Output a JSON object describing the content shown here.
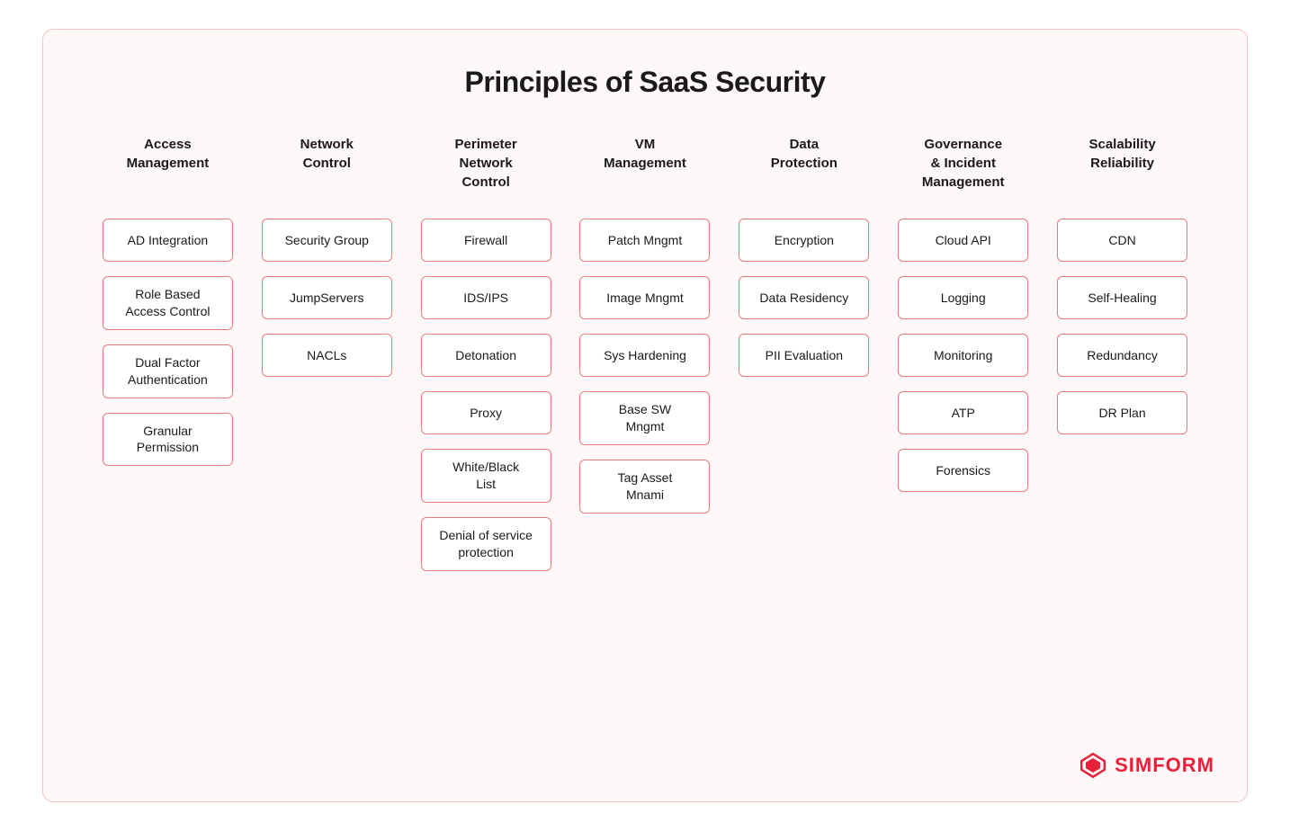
{
  "title": "Principles of SaaS Security",
  "columns": [
    {
      "id": "access-management",
      "header": "Access\nManagement",
      "items": [
        "AD Integration",
        "Role Based\nAccess Control",
        "Dual Factor\nAuthentication",
        "Granular\nPermission"
      ]
    },
    {
      "id": "network-control",
      "header": "Network\nControl",
      "items": [
        "Security Group",
        "JumpServers",
        "NACLs"
      ]
    },
    {
      "id": "perimeter-network-control",
      "header": "Perimeter\nNetwork\nControl",
      "items": [
        "Firewall",
        "IDS/IPS",
        "Detonation",
        "Proxy",
        "White/Black\nList",
        "Denial of service\nprotection"
      ]
    },
    {
      "id": "vm-management",
      "header": "VM\nManagement",
      "items": [
        "Patch Mngmt",
        "Image Mngmt",
        "Sys Hardening",
        "Base SW\nMngmt",
        "Tag Asset\nMnami"
      ]
    },
    {
      "id": "data-protection",
      "header": "Data\nProtection",
      "items": [
        "Encryption",
        "Data Residency",
        "PII Evaluation"
      ]
    },
    {
      "id": "governance-incident-management",
      "header": "Governance\n& Incident\nManagement",
      "items": [
        "Cloud API",
        "Logging",
        "Monitoring",
        "ATP",
        "Forensics"
      ]
    },
    {
      "id": "scalability-reliability",
      "header": "Scalability\nReliability",
      "items": [
        "CDN",
        "Self-Healing",
        "Redundancy",
        "DR Plan"
      ]
    }
  ],
  "logo": {
    "text": "SIMFORM"
  }
}
